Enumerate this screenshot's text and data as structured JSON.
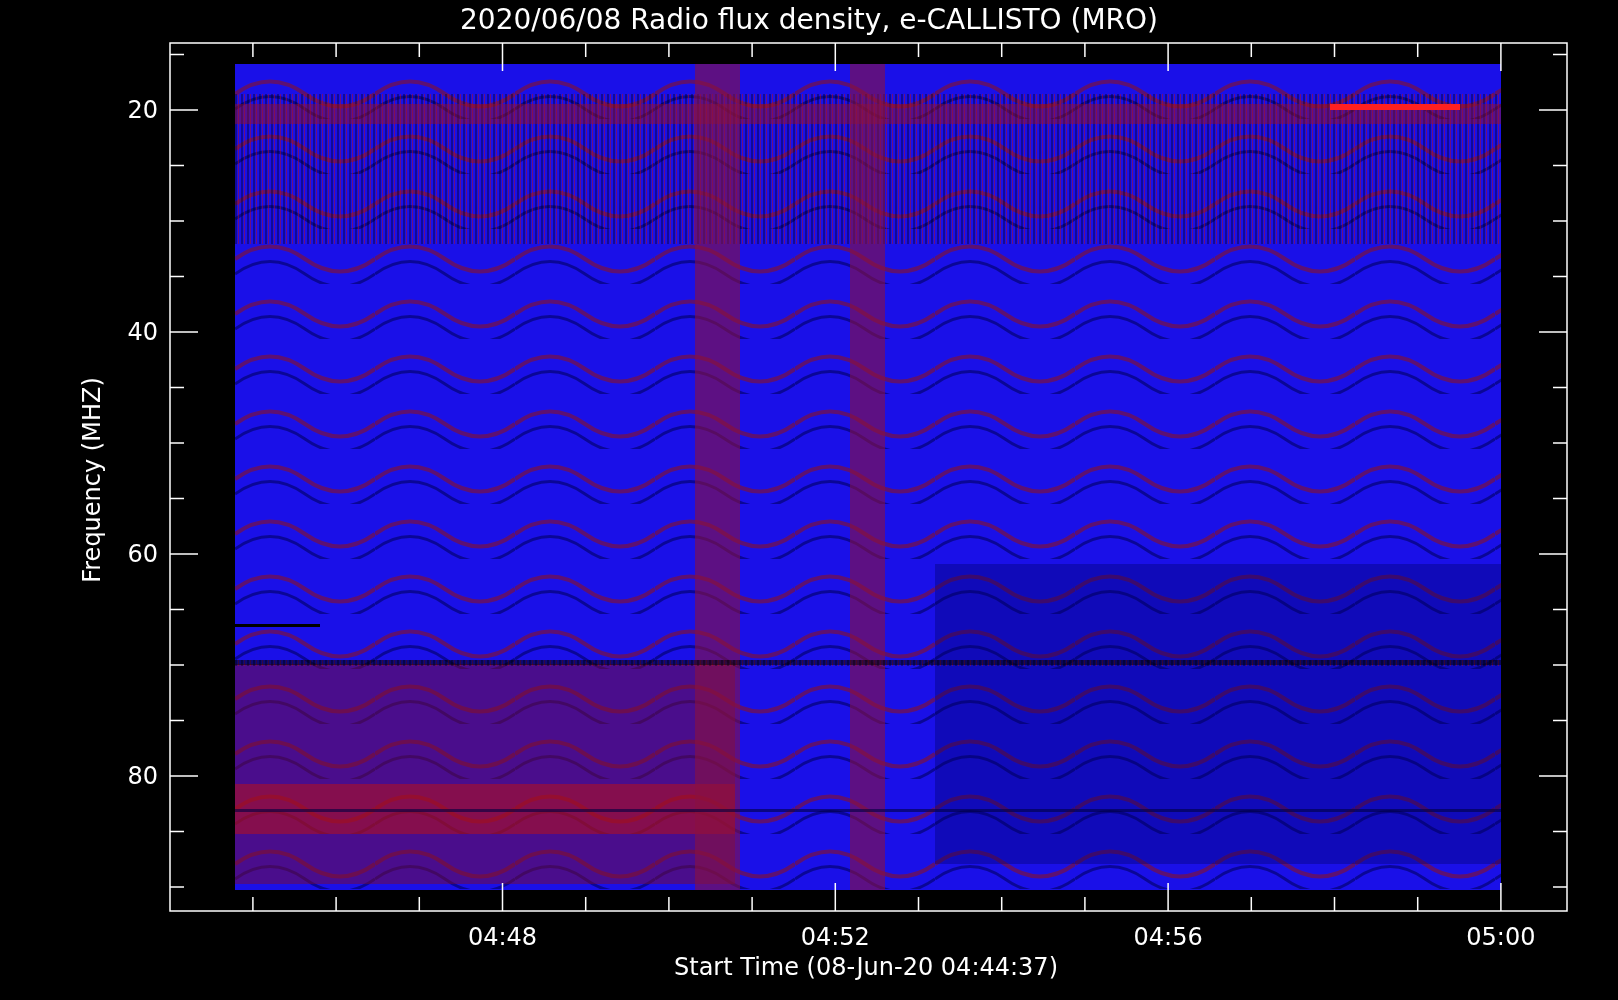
{
  "title": "2020/06/08  Radio flux density, e-CALLISTO (MRO)",
  "y_axis": {
    "label": "Frequency (MHZ)",
    "ticks": [
      "20",
      "40",
      "60",
      "80"
    ]
  },
  "x_axis": {
    "label": "Start Time (08-Jun-20 04:44:37)",
    "ticks": [
      "04:48",
      "04:52",
      "04:56",
      "05:00"
    ]
  }
}
